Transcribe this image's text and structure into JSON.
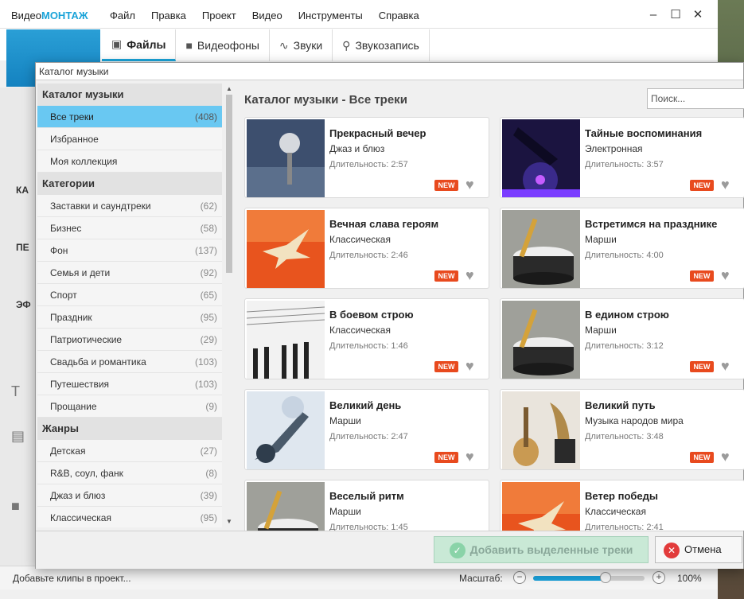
{
  "app": {
    "logo_part1": "Видео",
    "logo_part2": "МОНТАЖ",
    "menu": [
      "Файл",
      "Правка",
      "Проект",
      "Видео",
      "Инструменты",
      "Справка"
    ],
    "tabs": [
      {
        "label": "Файлы",
        "icon": "image-icon",
        "active": true
      },
      {
        "label": "Видеофоны",
        "icon": "camera-icon",
        "active": false
      },
      {
        "label": "Звуки",
        "icon": "soundwave-icon",
        "active": false
      },
      {
        "label": "Звукозапись",
        "icon": "microphone-icon",
        "active": false
      }
    ],
    "rail_labels": [
      "КА",
      "ПЕ",
      "ЭФ"
    ]
  },
  "status": {
    "left_text": "Добавьте клипы в проект...",
    "zoom_label": "Масштаб:",
    "zoom_value": "100%",
    "zoom_fraction": 0.65
  },
  "dialog": {
    "title": "Каталог музыки",
    "content_title": "Каталог музыки - Все треки",
    "search_placeholder": "Поиск...",
    "duration_label": "Длительность:",
    "badge": "NEW",
    "add_button": "Добавить выделенные треки",
    "cancel_button": "Отмена",
    "sections": [
      {
        "heading": "Каталог музыки",
        "items": [
          {
            "label": "Все треки",
            "count": "(408)",
            "selected": true
          },
          {
            "label": "Избранное",
            "count": ""
          },
          {
            "label": "Моя коллекция",
            "count": ""
          }
        ]
      },
      {
        "heading": "Категории",
        "items": [
          {
            "label": "Заставки и саундтреки",
            "count": "(62)"
          },
          {
            "label": "Бизнес",
            "count": "(58)"
          },
          {
            "label": "Фон",
            "count": "(137)"
          },
          {
            "label": "Семья и дети",
            "count": "(92)"
          },
          {
            "label": "Спорт",
            "count": "(65)"
          },
          {
            "label": "Праздник",
            "count": "(95)"
          },
          {
            "label": "Патриотические",
            "count": "(29)"
          },
          {
            "label": "Свадьба и романтика",
            "count": "(103)"
          },
          {
            "label": "Путешествия",
            "count": "(103)"
          },
          {
            "label": "Прощание",
            "count": "(9)"
          }
        ]
      },
      {
        "heading": "Жанры",
        "items": [
          {
            "label": "Детская",
            "count": "(27)"
          },
          {
            "label": "R&B, соул, фанк",
            "count": "(8)"
          },
          {
            "label": "Джаз и блюз",
            "count": "(39)"
          },
          {
            "label": "Классическая",
            "count": "(95)"
          }
        ]
      }
    ],
    "tracks": [
      {
        "title": "Прекрасный вечер",
        "genre": "Джаз и блюз",
        "duration": "2:57",
        "art": "microphone"
      },
      {
        "title": "Тайные воспоминания",
        "genre": "Электронная",
        "duration": "3:57",
        "art": "dj"
      },
      {
        "title": "Вечная слава героям",
        "genre": "Классическая",
        "duration": "2:46",
        "art": "dove"
      },
      {
        "title": "Встретимся на празднике",
        "genre": "Марши",
        "duration": "4:00",
        "art": "drum"
      },
      {
        "title": "В боевом строю",
        "genre": "Классическая",
        "duration": "1:46",
        "art": "piano"
      },
      {
        "title": "В едином строю",
        "genre": "Марши",
        "duration": "3:12",
        "art": "drum"
      },
      {
        "title": "Великий день",
        "genre": "Марши",
        "duration": "2:47",
        "art": "guitar"
      },
      {
        "title": "Великий путь",
        "genre": "Музыка народов мира",
        "duration": "3:48",
        "art": "instruments"
      },
      {
        "title": "Веселый ритм",
        "genre": "Марши",
        "duration": "1:45",
        "art": "drum"
      },
      {
        "title": "Ветер победы",
        "genre": "Классическая",
        "duration": "2:41",
        "art": "dove"
      }
    ]
  }
}
